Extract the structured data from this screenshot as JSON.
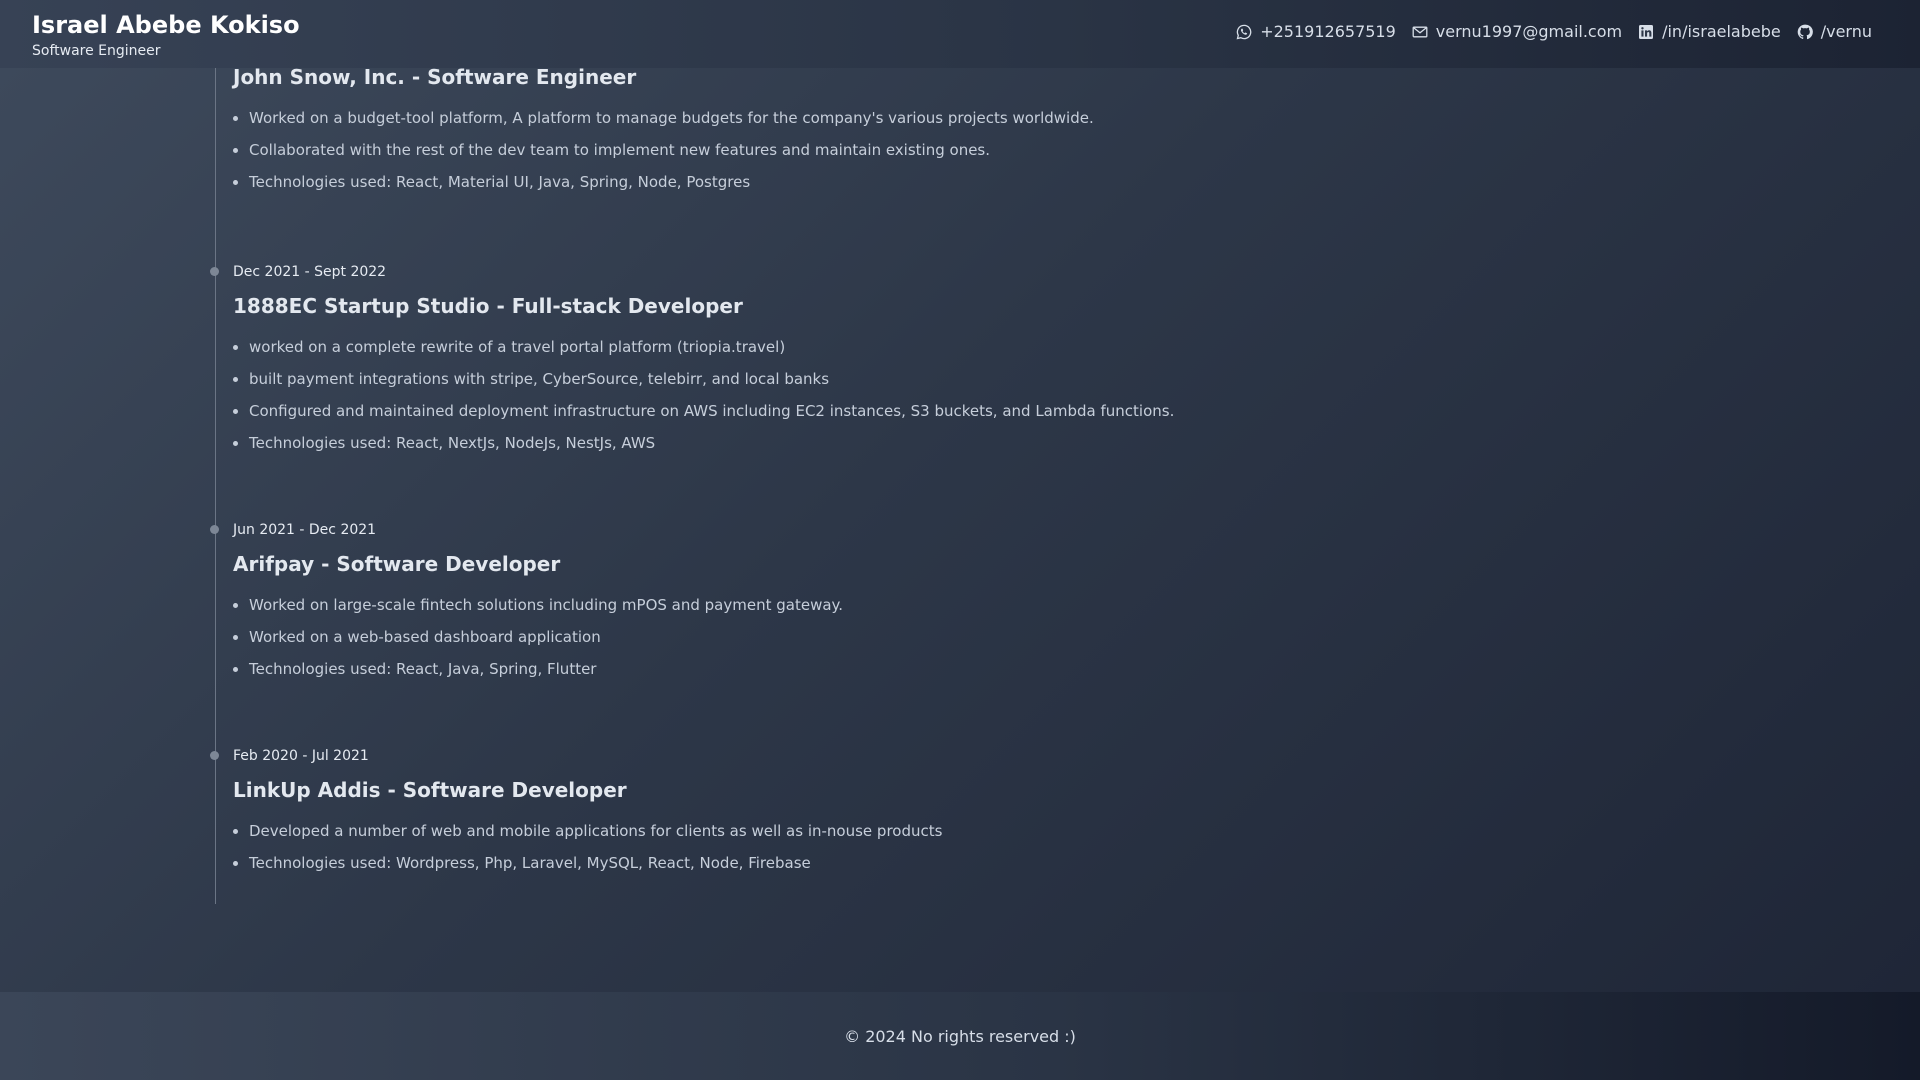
{
  "header": {
    "name": "Israel Abebe Kokiso",
    "title": "Software Engineer",
    "contacts": [
      {
        "icon": "whatsapp-icon",
        "text": "+251912657519"
      },
      {
        "icon": "mail-icon",
        "text": "vernu1997@gmail.com"
      },
      {
        "icon": "linkedin-icon",
        "text": "/in/israelabebe"
      },
      {
        "icon": "github-icon",
        "text": "/vernu"
      }
    ]
  },
  "experience": [
    {
      "date": "",
      "role": "John Snow, Inc. - Software Engineer",
      "bullets": [
        "Worked on a budget-tool platform, A platform to manage budgets for the company's various projects worldwide.",
        "Collaborated with the rest of the dev team to implement new features and maintain existing ones.",
        "Technologies used: React, Material UI, Java, Spring, Node, Postgres"
      ]
    },
    {
      "date": "Dec 2021 - Sept 2022",
      "role": "1888EC Startup Studio - Full-stack Developer",
      "bullets": [
        "worked on a complete rewrite of a travel portal platform (triopia.travel)",
        "built payment integrations with stripe, CyberSource, telebirr, and local banks",
        "Configured and maintained deployment infrastructure on AWS including EC2 instances, S3 buckets, and Lambda functions.",
        "Technologies used: React, NextJs, NodeJs, NestJs, AWS"
      ]
    },
    {
      "date": "Jun 2021 - Dec 2021",
      "role": "Arifpay - Software Developer",
      "bullets": [
        "Worked on large-scale fintech solutions including mPOS and payment gateway.",
        "Worked on a web-based dashboard application",
        "Technologies used: React, Java, Spring, Flutter"
      ]
    },
    {
      "date": "Feb 2020 - Jul 2021",
      "role": "LinkUp Addis - Software Developer",
      "bullets": [
        "Developed a number of web and mobile applications for clients as well as in-nouse products",
        "Technologies used: Wordpress, Php, Laravel, MySQL, React, Node, Firebase"
      ]
    }
  ],
  "footer": {
    "text": "© 2024 No rights reserved :)"
  }
}
